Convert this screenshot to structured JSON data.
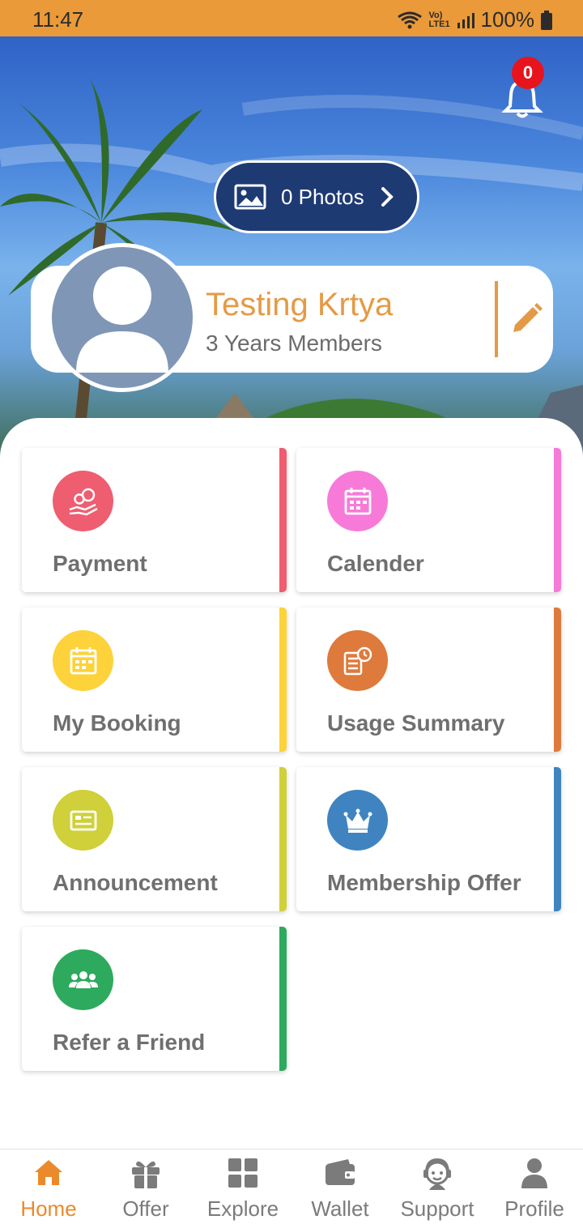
{
  "status_bar": {
    "time": "11:47",
    "network": "Vo) LTE1",
    "battery": "100%"
  },
  "notifications": {
    "count": "0"
  },
  "photos": {
    "label": "0 Photos"
  },
  "profile": {
    "name": "Testing Krtya",
    "membership": "3 Years Members"
  },
  "tiles": [
    {
      "label": "Payment",
      "icon": "payment-icon",
      "color": "#ef5d70",
      "accent": "#ef5d70"
    },
    {
      "label": "Calender",
      "icon": "calendar-icon",
      "color": "#f77ad8",
      "accent": "#f77ad8"
    },
    {
      "label": "My Booking",
      "icon": "booking-icon",
      "color": "#fdd23a",
      "accent": "#fdd23a"
    },
    {
      "label": "Usage Summary",
      "icon": "usage-icon",
      "color": "#de7a3c",
      "accent": "#de7a3c"
    },
    {
      "label": "Announcement",
      "icon": "announcement-icon",
      "color": "#cfd03a",
      "accent": "#cfd03a"
    },
    {
      "label": "Membership Offer",
      "icon": "crown-icon",
      "color": "#3f84c0",
      "accent": "#3f84c0"
    },
    {
      "label": "Refer a Friend",
      "icon": "group-icon",
      "color": "#2daa5d",
      "accent": "#2daa5d"
    }
  ],
  "bottom_nav": [
    {
      "label": "Home",
      "icon": "home-icon",
      "active": true
    },
    {
      "label": "Offer",
      "icon": "gift-icon",
      "active": false
    },
    {
      "label": "Explore",
      "icon": "grid-icon",
      "active": false
    },
    {
      "label": "Wallet",
      "icon": "wallet-icon",
      "active": false
    },
    {
      "label": "Support",
      "icon": "support-icon",
      "active": false
    },
    {
      "label": "Profile",
      "icon": "profile-icon",
      "active": false
    }
  ],
  "colors": {
    "status_bar": "#ea9a38",
    "accent": "#e49a45",
    "nav_active": "#ea8a2a",
    "nav_inactive": "#7b7b7b"
  }
}
